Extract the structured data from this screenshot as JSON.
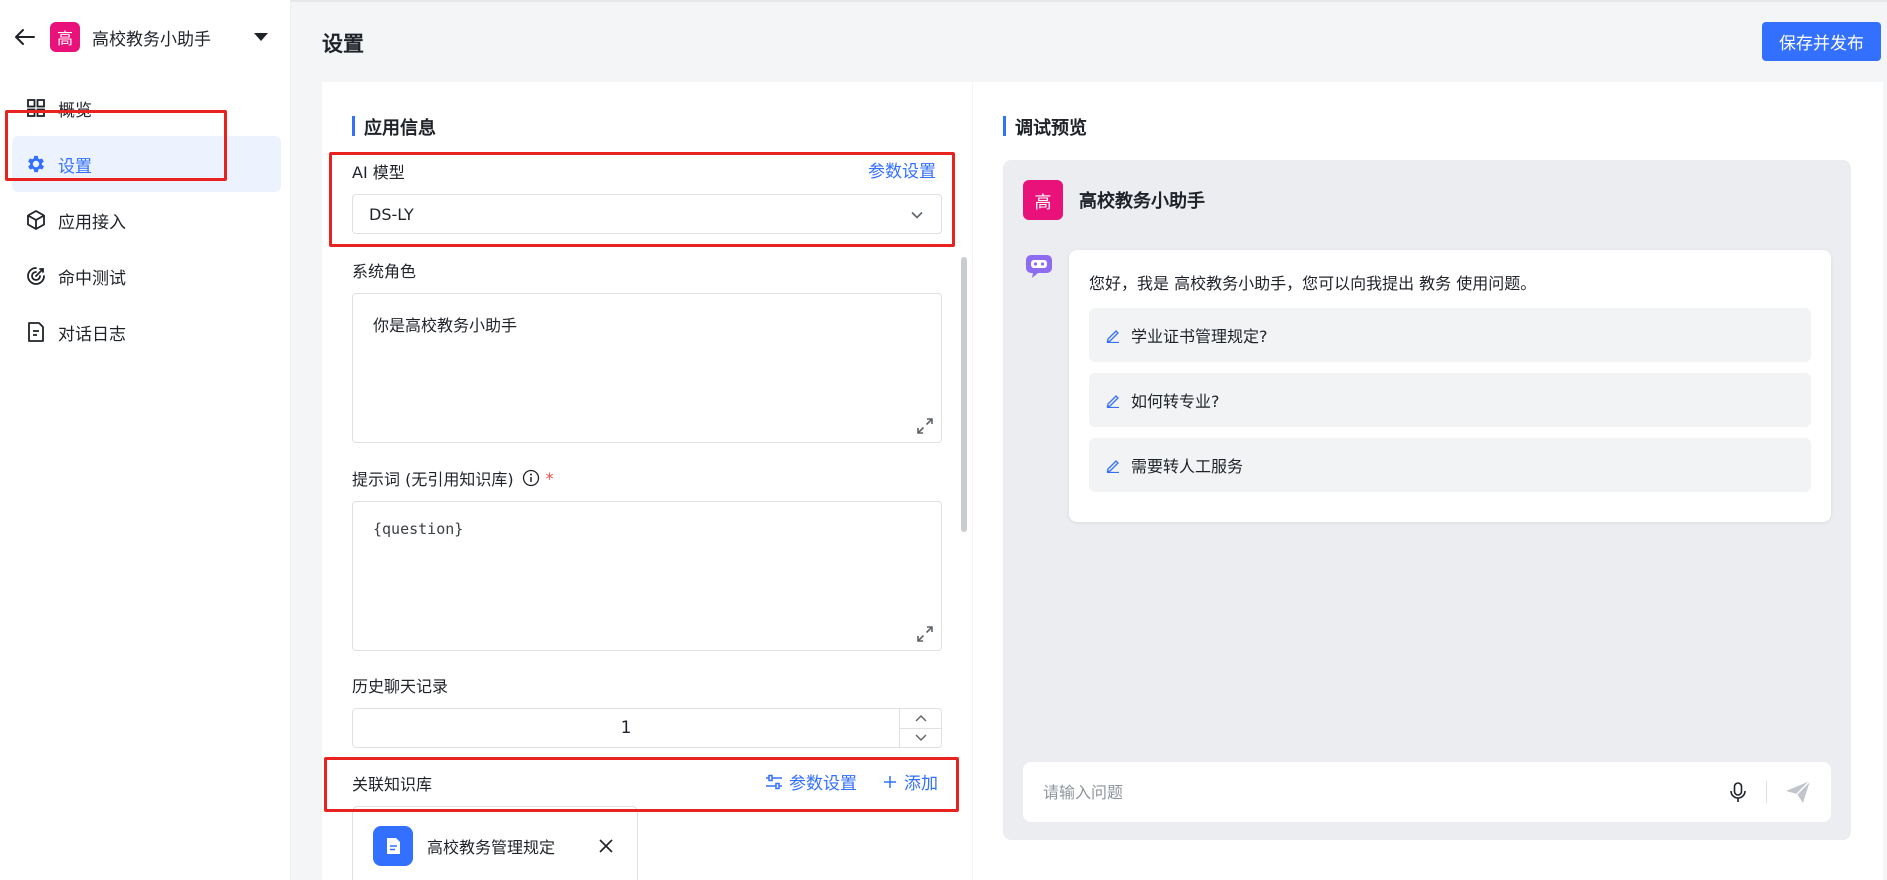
{
  "app": {
    "avatar_char": "高",
    "name": "高校教务小助手"
  },
  "nav": {
    "items": [
      {
        "label": "概览",
        "icon": "grid-icon"
      },
      {
        "label": "设置",
        "icon": "gear-icon",
        "active": true
      },
      {
        "label": "应用接入",
        "icon": "cube-icon"
      },
      {
        "label": "命中测试",
        "icon": "target-icon"
      },
      {
        "label": "对话日志",
        "icon": "document-icon"
      }
    ]
  },
  "header": {
    "title": "设置",
    "publish_label": "保存并发布"
  },
  "app_info": {
    "section_title": "应用信息",
    "ai_model_label": "AI 模型",
    "ai_model_param_link": "参数设置",
    "ai_model_value": "DS-LY",
    "system_role_label": "系统角色",
    "system_role_value": "你是高校教务小助手",
    "prompt_label": "提示词 (无引用知识库)",
    "prompt_required_mark": "*",
    "prompt_value": "{question}",
    "history_label": "历史聊天记录",
    "history_value": "1",
    "kb_label": "关联知识库",
    "kb_param_link": "参数设置",
    "kb_add_link": "添加",
    "kb_items": [
      {
        "name": "高校教务管理规定"
      }
    ]
  },
  "preview": {
    "section_title": "调试预览",
    "bot_avatar_char": "高",
    "bot_name": "高校教务小助手",
    "greeting": "您好，我是 高校教务小助手，您可以向我提出 教务 使用问题。",
    "suggestions": [
      "学业证书管理规定?",
      "如何转专业?",
      "需要转人工服务"
    ],
    "input_placeholder": "请输入问题"
  },
  "colors": {
    "accent": "#3370ff",
    "avatar_bg": "#e8127a",
    "highlight_box": "#e8231f"
  }
}
